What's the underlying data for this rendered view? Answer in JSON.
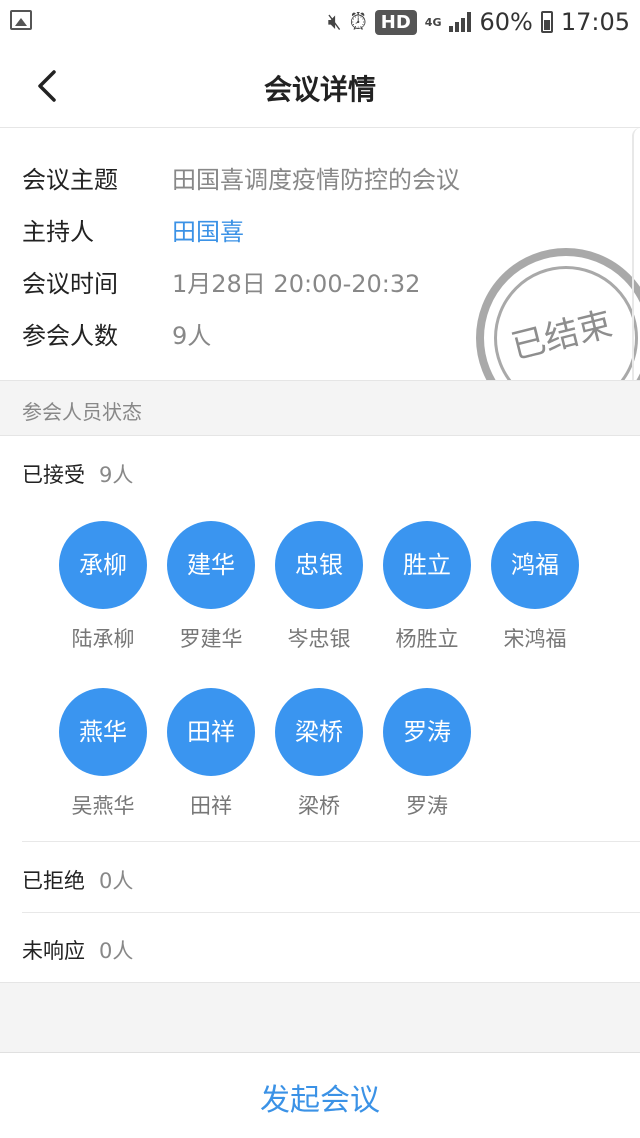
{
  "status_bar": {
    "network": "4G",
    "hd": "HD",
    "battery": "60%",
    "time": "17:05"
  },
  "nav": {
    "title": "会议详情"
  },
  "meeting": {
    "topic_label": "会议主题",
    "topic": "田国喜调度疫情防控的会议",
    "host_label": "主持人",
    "host": "田国喜",
    "time_label": "会议时间",
    "time": "1月28日 20:00-20:32",
    "count_label": "参会人数",
    "count": "9人",
    "stamp": "已结束"
  },
  "participants_section": {
    "title": "参会人员状态",
    "accepted_label": "已接受",
    "accepted_count": "9人",
    "accepted": [
      {
        "short": "承柳",
        "name": "陆承柳"
      },
      {
        "short": "建华",
        "name": "罗建华"
      },
      {
        "short": "忠银",
        "name": "岑忠银"
      },
      {
        "short": "胜立",
        "name": "杨胜立"
      },
      {
        "short": "鸿福",
        "name": "宋鸿福"
      },
      {
        "short": "燕华",
        "name": "吴燕华"
      },
      {
        "short": "田祥",
        "name": "田祥"
      },
      {
        "short": "梁桥",
        "name": "梁桥"
      },
      {
        "short": "罗涛",
        "name": "罗涛"
      }
    ],
    "rejected_label": "已拒绝",
    "rejected_count": "0人",
    "noresponse_label": "未响应",
    "noresponse_count": "0人"
  },
  "footer": {
    "button": "发起会议"
  },
  "colors": {
    "accent": "#3b92e6",
    "avatar": "#3a95f0",
    "stamp": "#a9a9a9"
  }
}
